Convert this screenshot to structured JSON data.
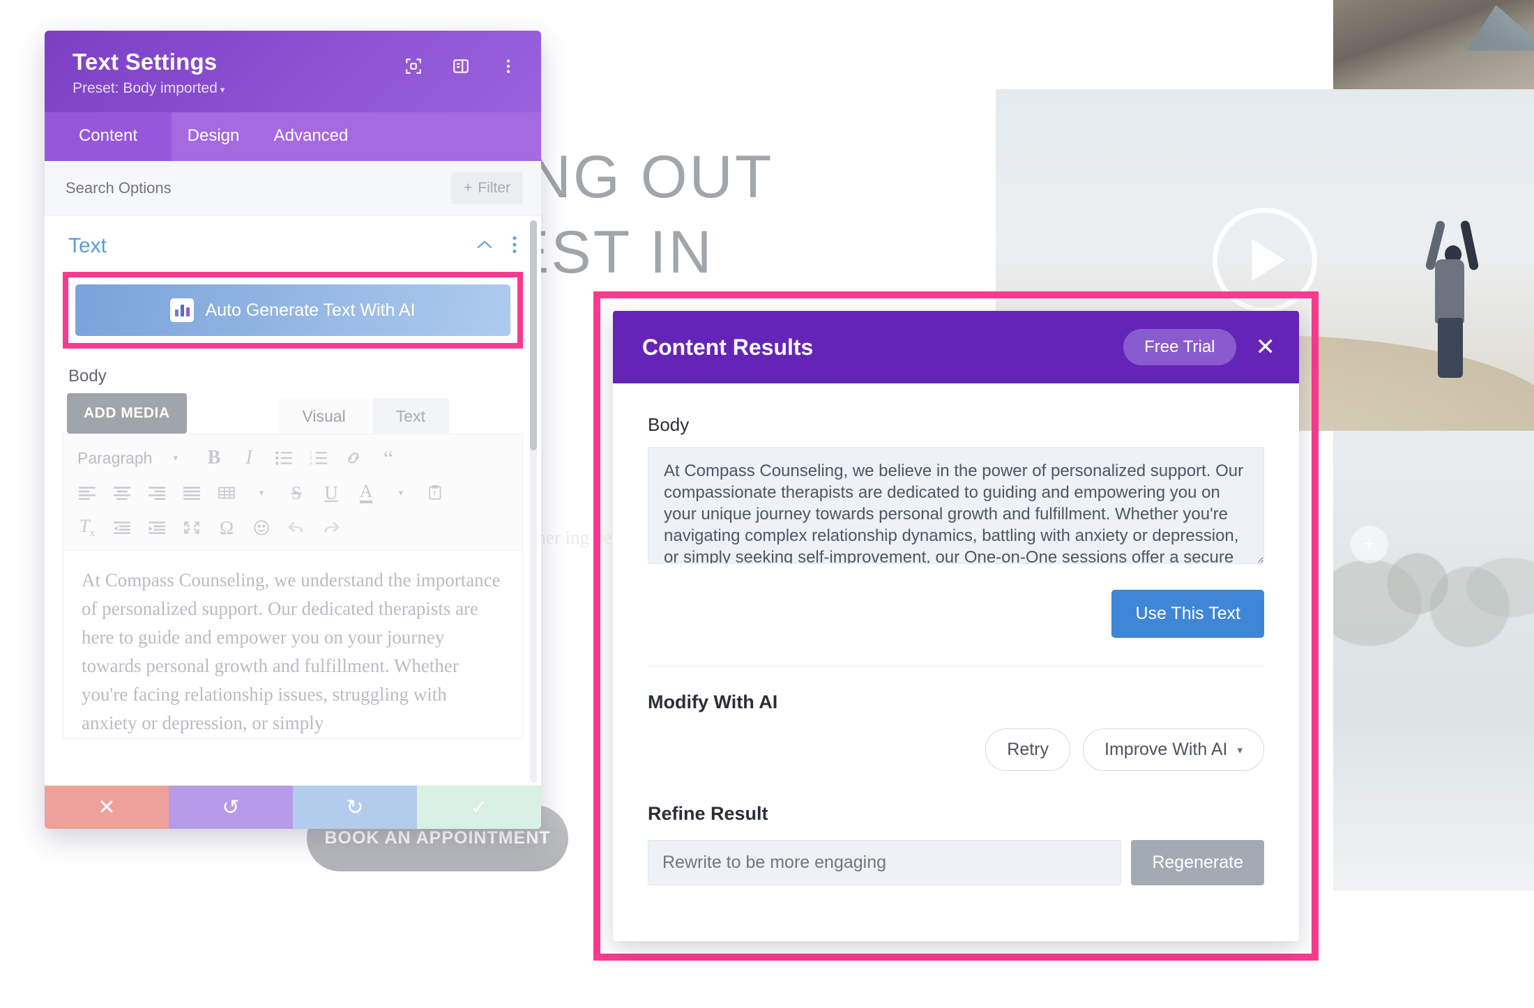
{
  "background": {
    "heading_line1": "ING OUT",
    "heading_line2": "EST IN",
    "paragraph": "e unders\nere to\nether\ning pe\nyou t\ncan di\nrmative",
    "cta_label": "BOOK AN APPOINTMENT",
    "lake_add_icon": "+",
    "play_icon": "play-icon"
  },
  "settings_panel": {
    "title": "Text Settings",
    "preset": "Preset: Body imported",
    "preset_caret": "▾",
    "header_icons": [
      "focus-target-icon",
      "layout-panel-icon",
      "more-vertical-icon"
    ],
    "tabs": [
      {
        "label": "Content",
        "active": true
      },
      {
        "label": "Design",
        "active": false
      },
      {
        "label": "Advanced",
        "active": false
      }
    ],
    "search_placeholder": "Search Options",
    "filter_label": "Filter",
    "filter_plus": "+",
    "section": {
      "title": "Text",
      "collapse_icon": "chevron-up-icon",
      "more_icon": "more-vertical-icon"
    },
    "ai_button_label": "Auto Generate Text With AI",
    "body_label": "Body",
    "add_media_label": "ADD MEDIA",
    "editor_tabs": [
      {
        "label": "Visual",
        "active": true
      },
      {
        "label": "Text",
        "active": false
      }
    ],
    "toolbar": {
      "format_select": "Paragraph",
      "format_caret": "▾",
      "row1": [
        "bold-icon",
        "italic-icon",
        "bulleted-list-icon",
        "numbered-list-icon",
        "link-icon",
        "blockquote-icon"
      ],
      "row2": [
        "align-left-icon",
        "align-center-icon",
        "align-right-icon",
        "align-justify-icon",
        "table-icon",
        "strikethrough-icon",
        "underline-icon",
        "text-color-icon",
        "paste-as-text-icon"
      ],
      "row3": [
        "clear-formatting-icon",
        "outdent-icon",
        "indent-icon",
        "fullscreen-icon",
        "special-character-icon",
        "emoji-icon",
        "undo-icon",
        "redo-icon"
      ]
    },
    "editor_text": "At Compass Counseling, we understand the importance of personalized support. Our dedicated therapists are here to guide and empower you on your journey towards personal growth and fulfillment. Whether you're facing relationship issues, struggling with anxiety or depression, or simply",
    "footer": [
      {
        "name": "cancel",
        "icon": "✕",
        "color": "#eda199"
      },
      {
        "name": "undo",
        "icon": "↺",
        "color": "#b79ae8"
      },
      {
        "name": "redo",
        "icon": "↻",
        "color": "#b4ccec"
      },
      {
        "name": "save",
        "icon": "✓",
        "color": "#d9f0e4"
      }
    ]
  },
  "content_results_modal": {
    "title": "Content Results",
    "free_trial_label": "Free Trial",
    "close_label": "✕",
    "body_label": "Body",
    "body_text": "At Compass Counseling, we believe in the power of personalized support. Our compassionate therapists are dedicated to guiding and empowering you on your unique journey towards personal growth and fulfillment. Whether you're navigating complex relationship dynamics, battling with anxiety or depression, or simply seeking self-improvement, our One-on-One sessions offer a secure and confidential space for you",
    "use_text_label": "Use This Text",
    "modify_title": "Modify With AI",
    "retry_label": "Retry",
    "improve_label": "Improve With AI",
    "improve_caret": "▾",
    "refine_title": "Refine Result",
    "refine_placeholder": "Rewrite to be more engaging",
    "regenerate_label": "Regenerate"
  },
  "colors": {
    "highlight_pink": "#f93a8f",
    "panel_purple": "#8a4fd0",
    "modal_purple": "#6524b8",
    "ai_blue": "#8eb2e1",
    "primary_blue": "#3f86d6",
    "section_blue": "#5c9ad6"
  }
}
